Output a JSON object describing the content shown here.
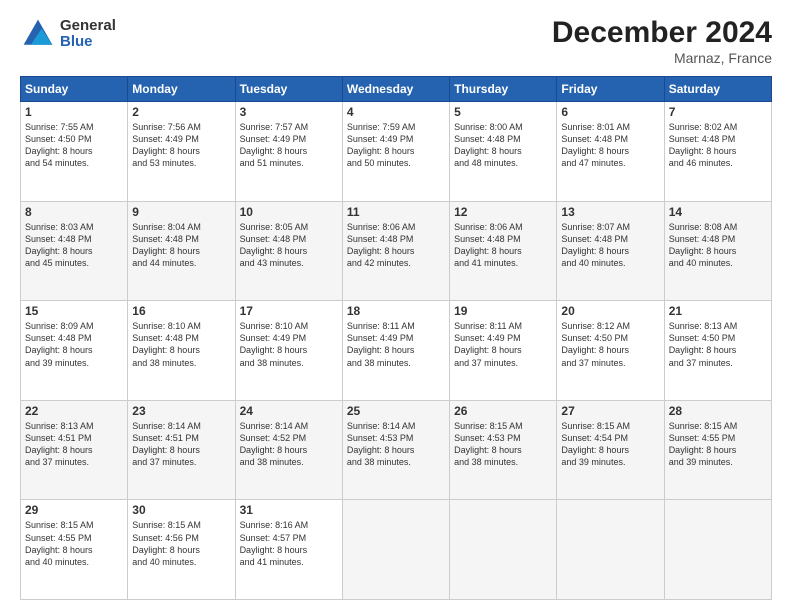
{
  "logo": {
    "general": "General",
    "blue": "Blue"
  },
  "title": {
    "month": "December 2024",
    "location": "Marnaz, France"
  },
  "days_of_week": [
    "Sunday",
    "Monday",
    "Tuesday",
    "Wednesday",
    "Thursday",
    "Friday",
    "Saturday"
  ],
  "weeks": [
    [
      {
        "day": "1",
        "sunrise": "7:55 AM",
        "sunset": "4:50 PM",
        "daylight": "8 hours and 54 minutes."
      },
      {
        "day": "2",
        "sunrise": "7:56 AM",
        "sunset": "4:49 PM",
        "daylight": "8 hours and 53 minutes."
      },
      {
        "day": "3",
        "sunrise": "7:57 AM",
        "sunset": "4:49 PM",
        "daylight": "8 hours and 51 minutes."
      },
      {
        "day": "4",
        "sunrise": "7:59 AM",
        "sunset": "4:49 PM",
        "daylight": "8 hours and 50 minutes."
      },
      {
        "day": "5",
        "sunrise": "8:00 AM",
        "sunset": "4:48 PM",
        "daylight": "8 hours and 48 minutes."
      },
      {
        "day": "6",
        "sunrise": "8:01 AM",
        "sunset": "4:48 PM",
        "daylight": "8 hours and 47 minutes."
      },
      {
        "day": "7",
        "sunrise": "8:02 AM",
        "sunset": "4:48 PM",
        "daylight": "8 hours and 46 minutes."
      }
    ],
    [
      {
        "day": "8",
        "sunrise": "8:03 AM",
        "sunset": "4:48 PM",
        "daylight": "8 hours and 45 minutes."
      },
      {
        "day": "9",
        "sunrise": "8:04 AM",
        "sunset": "4:48 PM",
        "daylight": "8 hours and 44 minutes."
      },
      {
        "day": "10",
        "sunrise": "8:05 AM",
        "sunset": "4:48 PM",
        "daylight": "8 hours and 43 minutes."
      },
      {
        "day": "11",
        "sunrise": "8:06 AM",
        "sunset": "4:48 PM",
        "daylight": "8 hours and 42 minutes."
      },
      {
        "day": "12",
        "sunrise": "8:06 AM",
        "sunset": "4:48 PM",
        "daylight": "8 hours and 41 minutes."
      },
      {
        "day": "13",
        "sunrise": "8:07 AM",
        "sunset": "4:48 PM",
        "daylight": "8 hours and 40 minutes."
      },
      {
        "day": "14",
        "sunrise": "8:08 AM",
        "sunset": "4:48 PM",
        "daylight": "8 hours and 40 minutes."
      }
    ],
    [
      {
        "day": "15",
        "sunrise": "8:09 AM",
        "sunset": "4:48 PM",
        "daylight": "8 hours and 39 minutes."
      },
      {
        "day": "16",
        "sunrise": "8:10 AM",
        "sunset": "4:48 PM",
        "daylight": "8 hours and 38 minutes."
      },
      {
        "day": "17",
        "sunrise": "8:10 AM",
        "sunset": "4:49 PM",
        "daylight": "8 hours and 38 minutes."
      },
      {
        "day": "18",
        "sunrise": "8:11 AM",
        "sunset": "4:49 PM",
        "daylight": "8 hours and 38 minutes."
      },
      {
        "day": "19",
        "sunrise": "8:11 AM",
        "sunset": "4:49 PM",
        "daylight": "8 hours and 37 minutes."
      },
      {
        "day": "20",
        "sunrise": "8:12 AM",
        "sunset": "4:50 PM",
        "daylight": "8 hours and 37 minutes."
      },
      {
        "day": "21",
        "sunrise": "8:13 AM",
        "sunset": "4:50 PM",
        "daylight": "8 hours and 37 minutes."
      }
    ],
    [
      {
        "day": "22",
        "sunrise": "8:13 AM",
        "sunset": "4:51 PM",
        "daylight": "8 hours and 37 minutes."
      },
      {
        "day": "23",
        "sunrise": "8:14 AM",
        "sunset": "4:51 PM",
        "daylight": "8 hours and 37 minutes."
      },
      {
        "day": "24",
        "sunrise": "8:14 AM",
        "sunset": "4:52 PM",
        "daylight": "8 hours and 38 minutes."
      },
      {
        "day": "25",
        "sunrise": "8:14 AM",
        "sunset": "4:53 PM",
        "daylight": "8 hours and 38 minutes."
      },
      {
        "day": "26",
        "sunrise": "8:15 AM",
        "sunset": "4:53 PM",
        "daylight": "8 hours and 38 minutes."
      },
      {
        "day": "27",
        "sunrise": "8:15 AM",
        "sunset": "4:54 PM",
        "daylight": "8 hours and 39 minutes."
      },
      {
        "day": "28",
        "sunrise": "8:15 AM",
        "sunset": "4:55 PM",
        "daylight": "8 hours and 39 minutes."
      }
    ],
    [
      {
        "day": "29",
        "sunrise": "8:15 AM",
        "sunset": "4:55 PM",
        "daylight": "8 hours and 40 minutes."
      },
      {
        "day": "30",
        "sunrise": "8:15 AM",
        "sunset": "4:56 PM",
        "daylight": "8 hours and 40 minutes."
      },
      {
        "day": "31",
        "sunrise": "8:16 AM",
        "sunset": "4:57 PM",
        "daylight": "8 hours and 41 minutes."
      },
      null,
      null,
      null,
      null
    ]
  ]
}
